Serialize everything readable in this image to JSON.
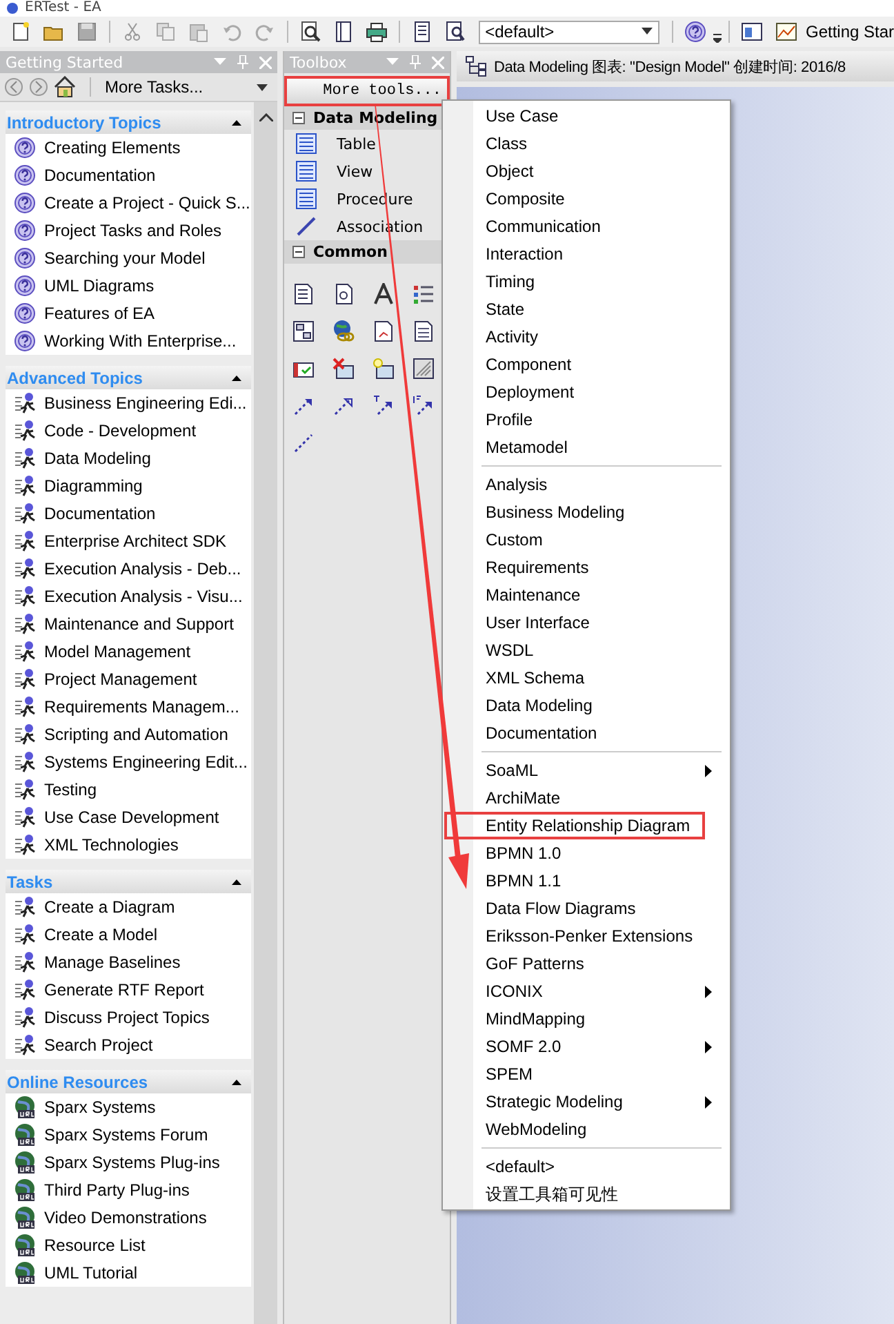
{
  "window": {
    "title": "ERTest - EA"
  },
  "toolbar": {
    "profile_combo": {
      "value": "<default>"
    },
    "getting_started_button": "Getting Star"
  },
  "getting_started": {
    "title": "Getting Started",
    "more_tasks": "More Tasks...",
    "sections": [
      {
        "title": "Introductory Topics",
        "kind": "help",
        "expanded": true,
        "items": [
          "Creating Elements",
          "Documentation",
          "Create a Project - Quick S...",
          "Project Tasks and Roles",
          "Searching your Model",
          "UML Diagrams",
          "Features of EA",
          "Working With Enterprise..."
        ]
      },
      {
        "title": "Advanced Topics",
        "kind": "task",
        "expanded": true,
        "items": [
          "Business Engineering Edi...",
          "Code - Development",
          "Data Modeling",
          "Diagramming",
          "Documentation",
          "Enterprise Architect SDK",
          "Execution Analysis - Deb...",
          "Execution Analysis - Visu...",
          "Maintenance and Support",
          "Model Management",
          "Project Management",
          "Requirements Managem...",
          "Scripting and Automation",
          "Systems Engineering Edit...",
          "Testing",
          "Use Case Development",
          "XML Technologies"
        ]
      },
      {
        "title": "Tasks",
        "kind": "task",
        "expanded": true,
        "items": [
          "Create a Diagram",
          "Create a Model",
          "Manage Baselines",
          "Generate RTF Report",
          "Discuss Project Topics",
          "Search Project"
        ]
      },
      {
        "title": "Online Resources",
        "kind": "url",
        "expanded": true,
        "items": [
          "Sparx Systems",
          "Sparx Systems Forum",
          "Sparx Systems Plug-ins",
          "Third Party Plug-ins",
          "Video Demonstrations",
          "Resource List",
          "UML Tutorial"
        ]
      }
    ]
  },
  "toolbox": {
    "title": "Toolbox",
    "more_tools": {
      "label": "More tools...",
      "highlighted": true
    },
    "groups": [
      {
        "title": "Data Modeling",
        "expanded": true,
        "items": [
          {
            "label": "Table",
            "kind": "table"
          },
          {
            "label": "View",
            "kind": "table"
          },
          {
            "label": "Procedure",
            "kind": "table"
          },
          {
            "label": "Association",
            "kind": "line"
          }
        ]
      },
      {
        "title": "Common",
        "expanded": true
      }
    ]
  },
  "diagram_tab": {
    "title": "Data Modeling 图表: \"Design Model\"  创建时间: 2016/8"
  },
  "menu": {
    "items": [
      {
        "kind": "item",
        "label": "Use Case",
        "submenu": false,
        "highlighted": false
      },
      {
        "kind": "item",
        "label": "Class",
        "submenu": false,
        "highlighted": false
      },
      {
        "kind": "item",
        "label": "Object",
        "submenu": false,
        "highlighted": false
      },
      {
        "kind": "item",
        "label": "Composite",
        "submenu": false,
        "highlighted": false
      },
      {
        "kind": "item",
        "label": "Communication",
        "submenu": false,
        "highlighted": false
      },
      {
        "kind": "item",
        "label": "Interaction",
        "submenu": false,
        "highlighted": false
      },
      {
        "kind": "item",
        "label": "Timing",
        "submenu": false,
        "highlighted": false
      },
      {
        "kind": "item",
        "label": "State",
        "submenu": false,
        "highlighted": false
      },
      {
        "kind": "item",
        "label": "Activity",
        "submenu": false,
        "highlighted": false
      },
      {
        "kind": "item",
        "label": "Component",
        "submenu": false,
        "highlighted": false
      },
      {
        "kind": "item",
        "label": "Deployment",
        "submenu": false,
        "highlighted": false
      },
      {
        "kind": "item",
        "label": "Profile",
        "submenu": false,
        "highlighted": false
      },
      {
        "kind": "item",
        "label": "Metamodel",
        "submenu": false,
        "highlighted": false
      },
      {
        "kind": "separator"
      },
      {
        "kind": "item",
        "label": "Analysis",
        "submenu": false,
        "highlighted": false
      },
      {
        "kind": "item",
        "label": "Business Modeling",
        "submenu": false,
        "highlighted": false
      },
      {
        "kind": "item",
        "label": "Custom",
        "submenu": false,
        "highlighted": false
      },
      {
        "kind": "item",
        "label": "Requirements",
        "submenu": false,
        "highlighted": false
      },
      {
        "kind": "item",
        "label": "Maintenance",
        "submenu": false,
        "highlighted": false
      },
      {
        "kind": "item",
        "label": "User Interface",
        "submenu": false,
        "highlighted": false
      },
      {
        "kind": "item",
        "label": "WSDL",
        "submenu": false,
        "highlighted": false
      },
      {
        "kind": "item",
        "label": "XML Schema",
        "submenu": false,
        "highlighted": false
      },
      {
        "kind": "item",
        "label": "Data Modeling",
        "submenu": false,
        "highlighted": false
      },
      {
        "kind": "item",
        "label": "Documentation",
        "submenu": false,
        "highlighted": false
      },
      {
        "kind": "separator"
      },
      {
        "kind": "item",
        "label": "SoaML",
        "submenu": true,
        "highlighted": false
      },
      {
        "kind": "item",
        "label": "ArchiMate",
        "submenu": false,
        "highlighted": false
      },
      {
        "kind": "item",
        "label": "Entity Relationship Diagram",
        "submenu": false,
        "highlighted": true
      },
      {
        "kind": "item",
        "label": "BPMN 1.0",
        "submenu": false,
        "highlighted": false
      },
      {
        "kind": "item",
        "label": "BPMN 1.1",
        "submenu": false,
        "highlighted": false
      },
      {
        "kind": "item",
        "label": "Data Flow Diagrams",
        "submenu": false,
        "highlighted": false
      },
      {
        "kind": "item",
        "label": "Eriksson-Penker Extensions",
        "submenu": false,
        "highlighted": false
      },
      {
        "kind": "item",
        "label": "GoF Patterns",
        "submenu": false,
        "highlighted": false
      },
      {
        "kind": "item",
        "label": "ICONIX",
        "submenu": true,
        "highlighted": false
      },
      {
        "kind": "item",
        "label": "MindMapping",
        "submenu": false,
        "highlighted": false
      },
      {
        "kind": "item",
        "label": "SOMF 2.0",
        "submenu": true,
        "highlighted": false
      },
      {
        "kind": "item",
        "label": "SPEM",
        "submenu": false,
        "highlighted": false
      },
      {
        "kind": "item",
        "label": "Strategic Modeling",
        "submenu": true,
        "highlighted": false
      },
      {
        "kind": "item",
        "label": "WebModeling",
        "submenu": false,
        "highlighted": false
      },
      {
        "kind": "separator"
      },
      {
        "kind": "item",
        "label": "<default>",
        "submenu": false,
        "highlighted": false
      },
      {
        "kind": "item",
        "label": "设置工具箱可见性",
        "submenu": false,
        "highlighted": false
      }
    ]
  }
}
